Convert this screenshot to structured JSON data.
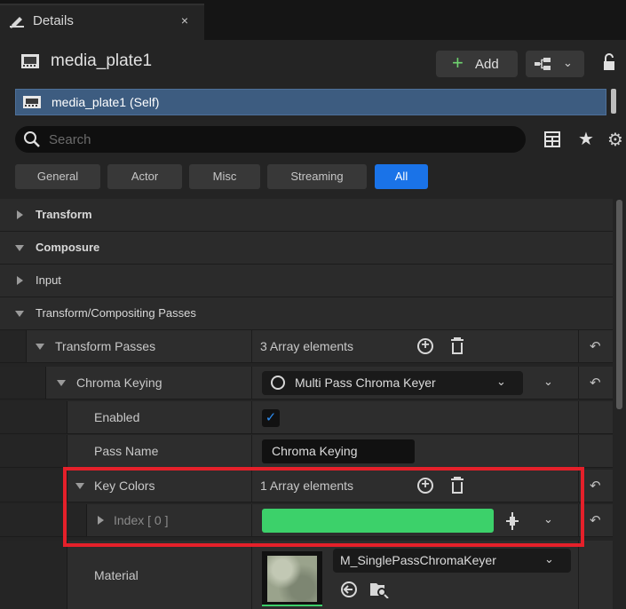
{
  "tab": {
    "title": "Details",
    "close": "×"
  },
  "actor": {
    "name": "media_plate1",
    "add_label": "Add",
    "add_plus": "+",
    "chevron": "⌄"
  },
  "self_row": {
    "label": "media_plate1 (Self)"
  },
  "search": {
    "placeholder": "Search",
    "value": ""
  },
  "filters": [
    {
      "label": "General",
      "active": false
    },
    {
      "label": "Actor",
      "active": false
    },
    {
      "label": "Misc",
      "active": false
    },
    {
      "label": "Streaming",
      "active": false
    },
    {
      "label": "All",
      "active": true
    }
  ],
  "categories": {
    "transform": "Transform",
    "composure": "Composure",
    "input": "Input",
    "tcp": "Transform/Compositing Passes"
  },
  "properties": {
    "transform_passes": {
      "name": "Transform Passes",
      "value": "3 Array elements"
    },
    "chroma_keying": {
      "name": "Chroma Keying",
      "value": "Multi Pass Chroma Keyer"
    },
    "enabled": {
      "name": "Enabled",
      "checked": true,
      "check": "✓"
    },
    "pass_name": {
      "name": "Pass Name",
      "value": "Chroma Keying"
    },
    "key_colors": {
      "name": "Key Colors",
      "value": "1 Array elements"
    },
    "index0": {
      "name": "Index [ 0 ]",
      "color": "#3cd16a"
    },
    "material": {
      "name": "Material",
      "value": "M_SinglePassChromaKeyer"
    }
  },
  "icons": {
    "reset": "↶",
    "plus": "+",
    "chevron": "⌄",
    "browse": "⋲",
    "star": "★",
    "gear": "⚙"
  },
  "colors": {
    "accent": "#1a73e8",
    "selection": "#3d5c80",
    "highlight": "#e5202a",
    "key_color": "#3cd16a"
  }
}
